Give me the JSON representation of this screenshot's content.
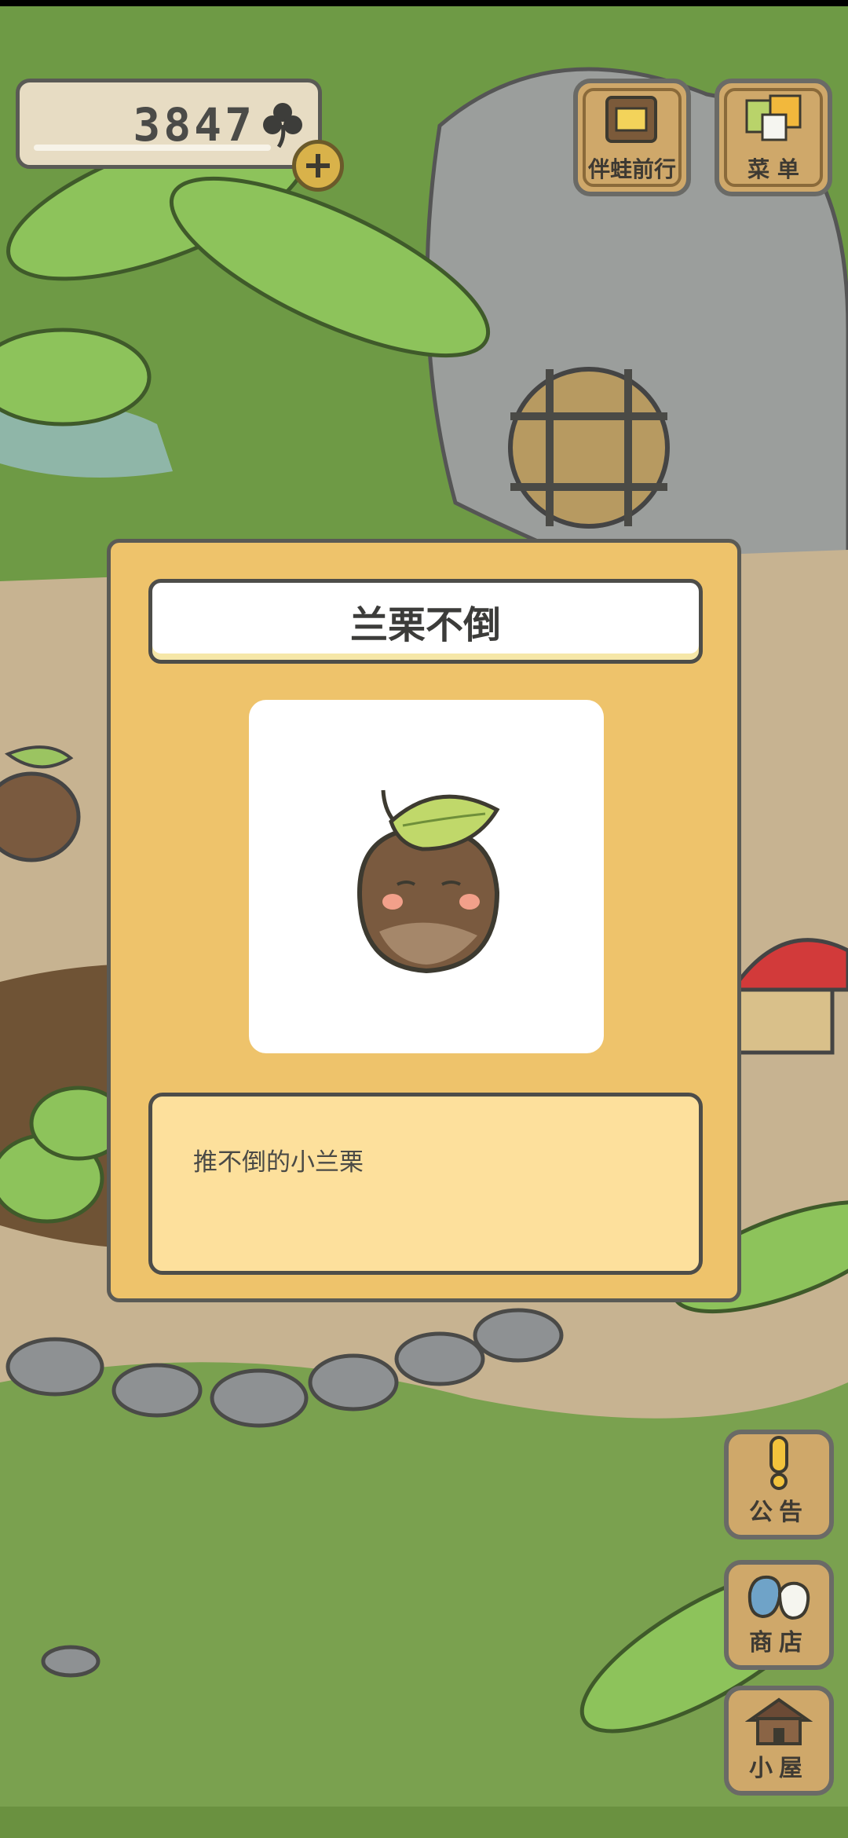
{
  "hud": {
    "clover_count": "3847",
    "clover_icon": "clover-icon",
    "add_icon": "plus-icon"
  },
  "top_buttons": {
    "travel_label": "伴蛙前行",
    "menu_label": "菜 单"
  },
  "dialog": {
    "title": "兰栗不倒",
    "item_icon": "chestnut-with-leaf",
    "description": "推不倒的小兰栗"
  },
  "side_buttons": {
    "notice_label": "公告",
    "shop_label": "商店",
    "house_label": "小屋"
  },
  "colors": {
    "dialog_bg": "#eec36b",
    "description_bg": "#fde09c",
    "button_wood": "#cfa86a",
    "outline": "#5a5a55"
  }
}
